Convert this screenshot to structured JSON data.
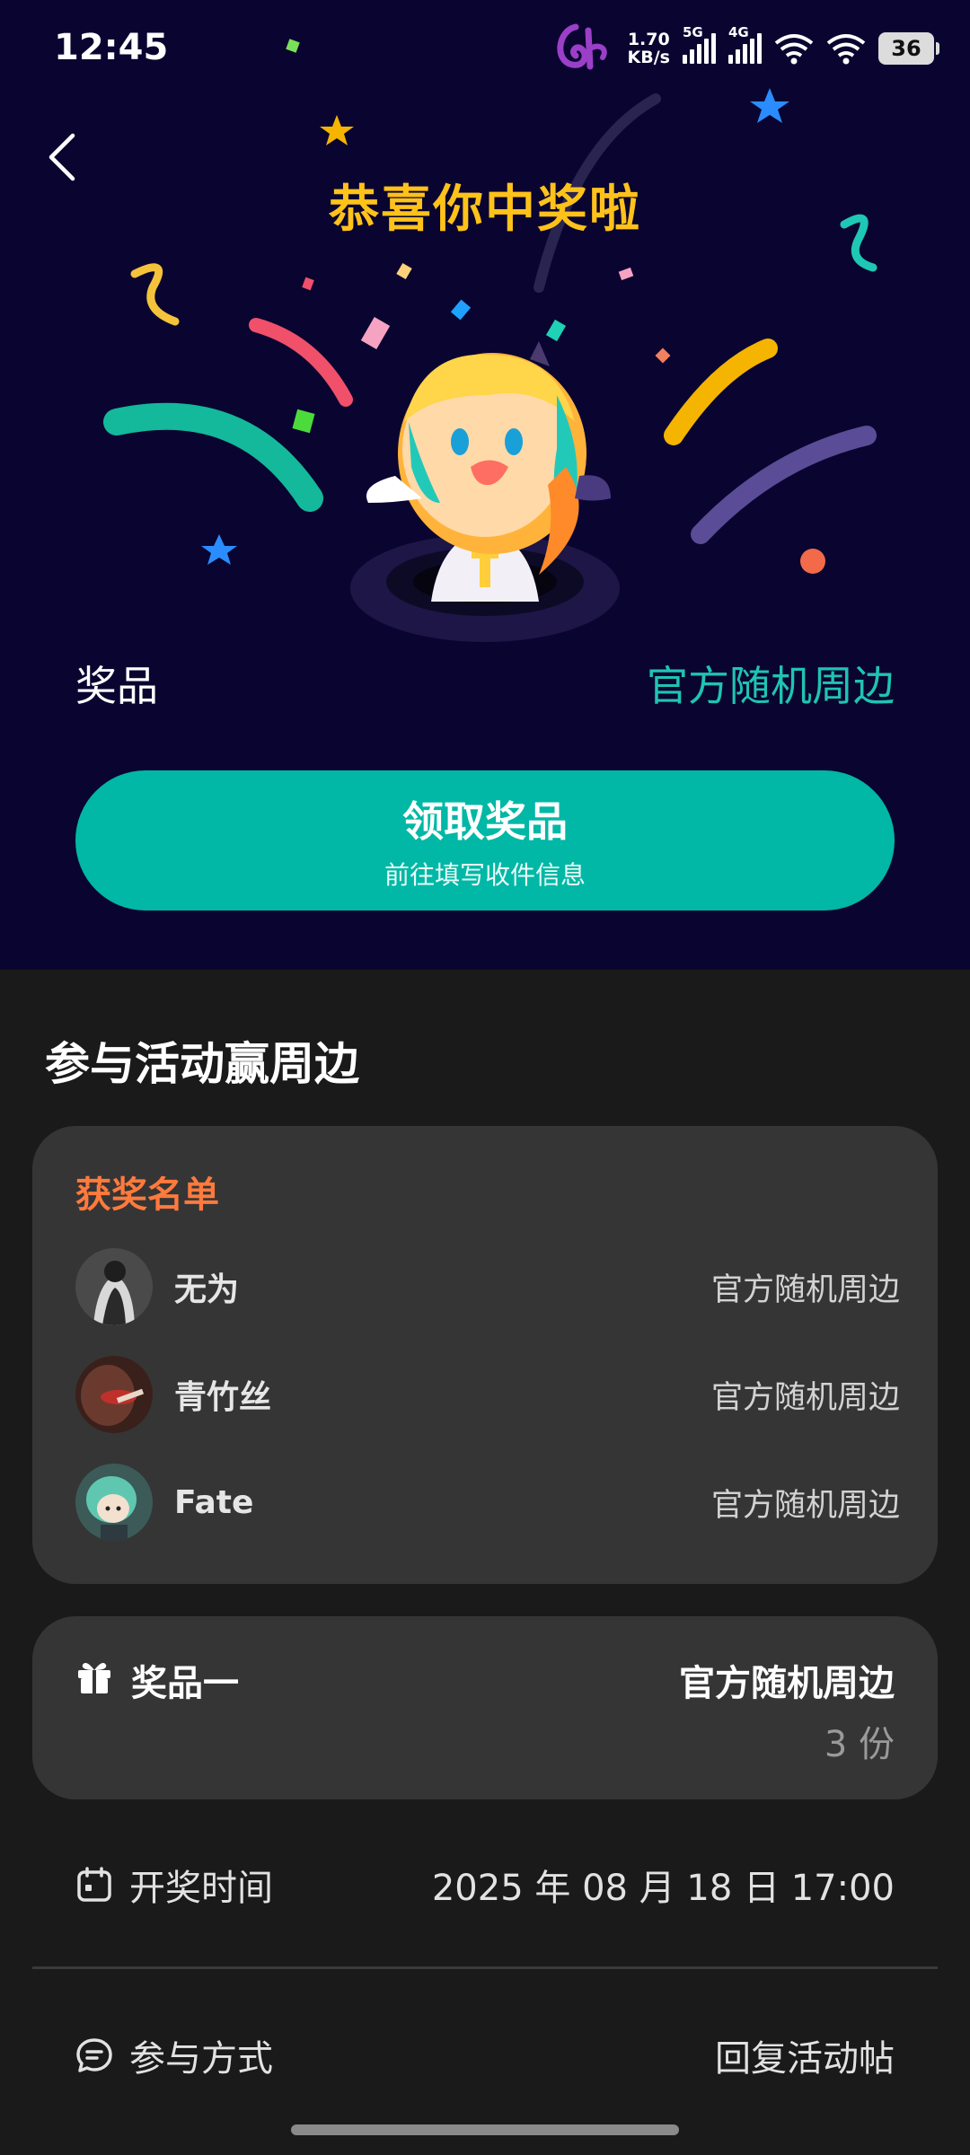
{
  "status_bar": {
    "time": "12:45",
    "net_speed_value": "1.70",
    "net_speed_unit": "KB/s",
    "signal_1_label": "5G",
    "signal_2_label": "4G",
    "battery": "36"
  },
  "hero": {
    "title": "恭喜你中奖啦",
    "prize_label": "奖品",
    "prize_value": "官方随机周边",
    "claim_button": {
      "title": "领取奖品",
      "subtitle": "前往填写收件信息"
    }
  },
  "section_title": "参与活动赢周边",
  "winners": {
    "title": "获奖名单",
    "list": [
      {
        "name": "无为",
        "prize": "官方随机周边"
      },
      {
        "name": "青竹丝",
        "prize": "官方随机周边"
      },
      {
        "name": "Fate",
        "prize": "官方随机周边"
      }
    ]
  },
  "prize_card": {
    "name": "奖品一",
    "value": "官方随机周边",
    "quantity": "3 份"
  },
  "draw_time": {
    "label": "开奖时间",
    "value": "2025 年 08 月 18 日 17:00"
  },
  "participation": {
    "label": "参与方式",
    "value": "回复活动帖"
  },
  "colors": {
    "hero_bg": "#0a0530",
    "accent_teal": "#00b8a5",
    "title_gold": "#ffc21a",
    "winners_orange": "#ff7a3d"
  }
}
